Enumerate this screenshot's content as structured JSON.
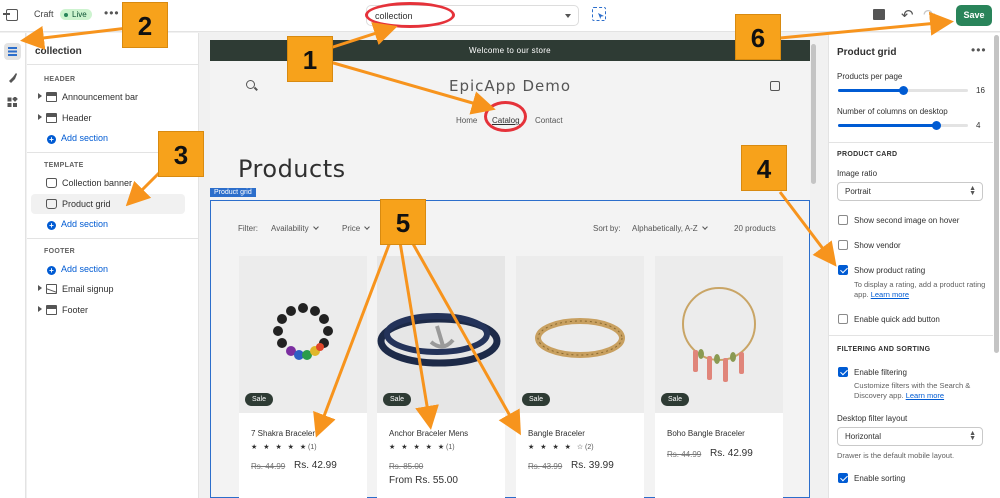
{
  "topbar": {
    "theme_name": "Craft",
    "status": "Live",
    "more": "•••",
    "template_select": "collection",
    "save_label": "Save"
  },
  "sidebar": {
    "title": "collection",
    "header_group": "HEADER",
    "header_items": [
      "Announcement bar",
      "Header"
    ],
    "template_group": "TEMPLATE",
    "template_items": [
      "Collection banner",
      "Product grid"
    ],
    "footer_group": "FOOTER",
    "footer_items": [
      "Email signup",
      "Footer"
    ],
    "add_section": "Add section"
  },
  "store": {
    "announcement": "Welcome to our store",
    "brand": "EpicApp Demo",
    "nav": [
      "Home",
      "Catalog",
      "Contact"
    ],
    "heading": "Products",
    "grid_tag": "Product grid",
    "filter_label": "Filter:",
    "filter_availability": "Availability",
    "filter_price": "Price",
    "sort_label": "Sort by:",
    "sort_value": "Alphabetically, A-Z",
    "count": "20 products",
    "products": [
      {
        "name": "7 Shakra Braceler",
        "stars": "★ ★ ★ ★ ★",
        "reviews": "(1)",
        "old_price": "Rs. 44.99",
        "price": "Rs. 42.99",
        "from_price": "",
        "badge": "Sale"
      },
      {
        "name": "Anchor Braceler Mens",
        "stars": "★ ★ ★ ★ ★",
        "reviews": "(1)",
        "old_price": "Rs. 85.00",
        "price": "",
        "from_price": "From Rs. 55.00",
        "badge": "Sale"
      },
      {
        "name": "Bangle Braceler",
        "stars": "★ ★ ★ ★ ☆",
        "reviews": "(2)",
        "old_price": "Rs. 43.99",
        "price": "Rs. 39.99",
        "from_price": "",
        "badge": "Sale"
      },
      {
        "name": "Boho Bangle Braceler",
        "stars": "",
        "reviews": "",
        "old_price": "Rs. 44.99",
        "price": "Rs. 42.99",
        "from_price": "",
        "badge": "Sale"
      }
    ]
  },
  "settings": {
    "title": "Product grid",
    "products_per_page_label": "Products per page",
    "products_per_page": "16",
    "products_per_page_fraction": 0.5,
    "columns_label": "Number of columns on desktop",
    "columns": "4",
    "columns_fraction": 0.75,
    "card_head": "PRODUCT CARD",
    "image_ratio_label": "Image ratio",
    "image_ratio": "Portrait",
    "second_image": "Show second image on hover",
    "show_vendor": "Show vendor",
    "show_rating": "Show product rating",
    "rating_help": "To display a rating, add a product rating app.",
    "learn_more": "Learn more",
    "quick_add": "Enable quick add button",
    "filter_head": "FILTERING AND SORTING",
    "enable_filtering": "Enable filtering",
    "filtering_help": "Customize filters with the Search & Discovery app.",
    "desktop_filter_label": "Desktop filter layout",
    "desktop_filter": "Horizontal",
    "drawer_help": "Drawer is the default mobile layout.",
    "enable_sorting": "Enable sorting"
  },
  "annotations": [
    "1",
    "2",
    "3",
    "4",
    "5",
    "6"
  ],
  "colors": {
    "accent": "#005bd3",
    "save": "#29845a",
    "callout": "#f7a21b",
    "arrow": "#f7941d",
    "highlight": "#e5323a"
  }
}
